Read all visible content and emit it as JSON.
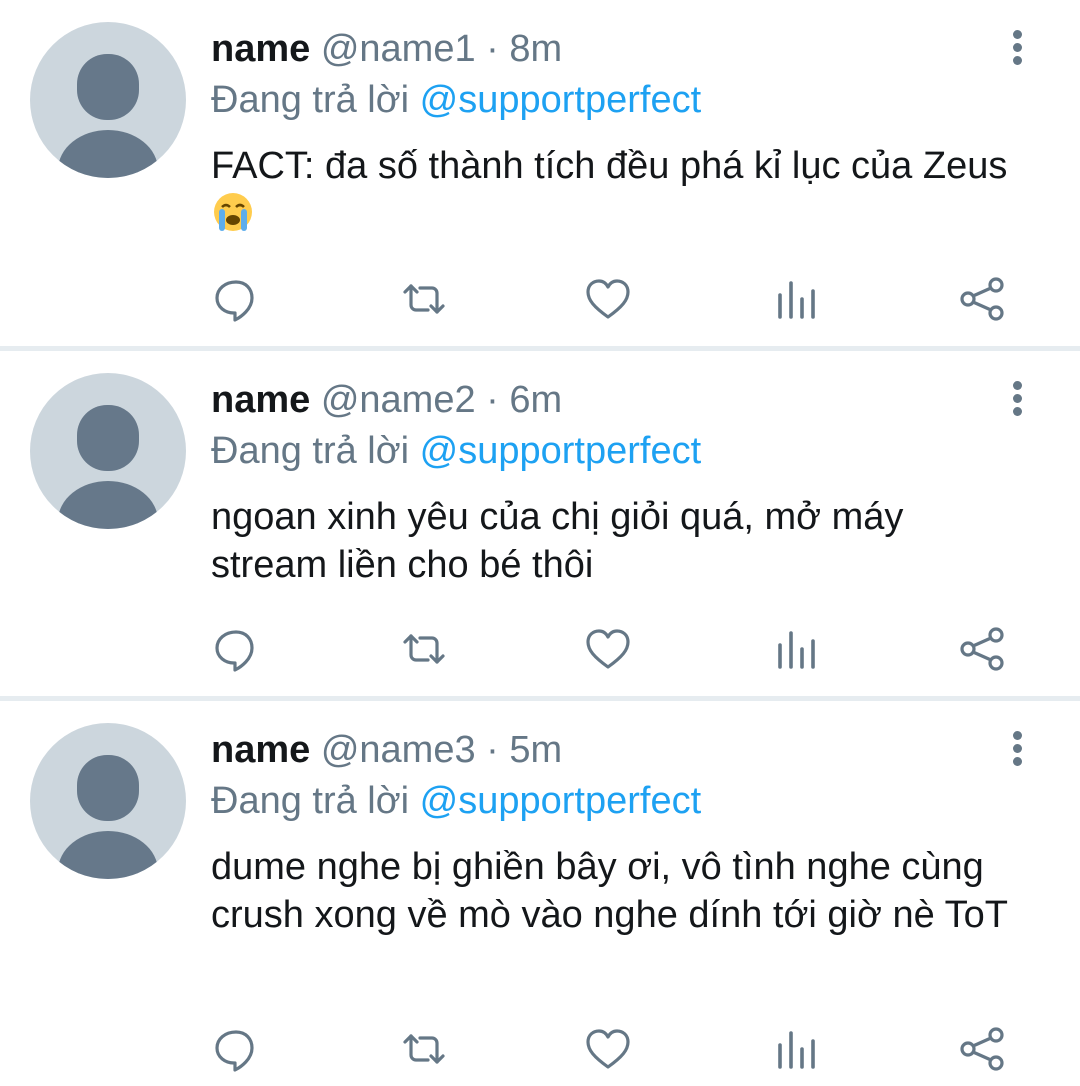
{
  "tweets": [
    {
      "name": "name",
      "handle": "@name1",
      "separator": "·",
      "time": "8m",
      "reply_prefix": "Đang trả lời",
      "reply_to": "@supportperfect",
      "text": "FACT: đa số thành tích đều phá kỉ lục của Zeus",
      "emoji": "😭"
    },
    {
      "name": "name",
      "handle": "@name2",
      "separator": "·",
      "time": "6m",
      "reply_prefix": "Đang trả lời",
      "reply_to": "@supportperfect",
      "text": "ngoan xinh yêu của chị giỏi quá, mở máy stream liền cho bé thôi"
    },
    {
      "name": "name",
      "handle": "@name3",
      "separator": "·",
      "time": "5m",
      "reply_prefix": "Đang trả lời",
      "reply_to": "@supportperfect",
      "text": "dume nghe bị ghiền bây ơi, vô tình nghe cùng crush xong về mò vào nghe dính tới giờ nè ToT"
    }
  ],
  "icons": {
    "avatar": "default-avatar-icon",
    "more": "more-vertical-icon",
    "reply": "reply-icon",
    "retweet": "retweet-icon",
    "like": "heart-icon",
    "stats": "analytics-icon",
    "share": "share-icon"
  },
  "colors": {
    "accent": "#1da1f2",
    "secondary_text": "#657786",
    "primary_text": "#14171a",
    "avatar_bg": "#ccd6dd",
    "avatar_fg": "#66788a",
    "divider": "#e6ecf0"
  }
}
